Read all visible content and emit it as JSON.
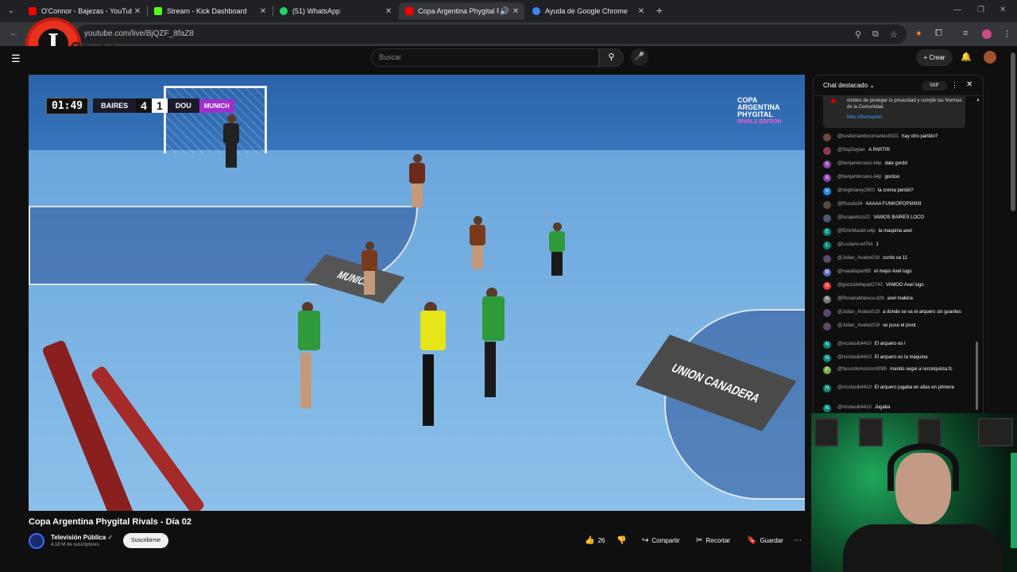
{
  "browser": {
    "tabs": [
      {
        "label": "O'Connor - Bajezas - YouTube",
        "favicon_color": "#ff0000",
        "active": false
      },
      {
        "label": "Stream - Kick Dashboard",
        "favicon_color": "#53fc18",
        "active": false
      },
      {
        "label": "(51) WhatsApp",
        "favicon_color": "#25d366",
        "active": false
      },
      {
        "label": "Copa Argentina Phygital Ri",
        "favicon_color": "#ff0000",
        "active": true
      },
      {
        "label": "Ayuda de Google Chrome",
        "favicon_color": "#4285f4",
        "active": false
      }
    ],
    "new_tab_icon": "plus-icon",
    "url": "youtube.com/live/BjQZF_8faZ8"
  },
  "overlay_logo": {
    "letter": "I",
    "text": "esaT"
  },
  "youtube": {
    "search_placeholder": "Buscar",
    "create_label": "Crear"
  },
  "video": {
    "scoreboard": {
      "time": "01:49",
      "home_team": "BAIRES",
      "home_score": "4",
      "away_score": "1",
      "away_team": "DOU",
      "sponsor": "MUNICH"
    },
    "corner_logo": {
      "line1": "COPA",
      "line2": "ARGENTINA",
      "line3": "PHYGITAL",
      "sub": "RIVALS EDITION"
    },
    "ad_left": "MUNICH",
    "ad_right": "UNION CANADERA",
    "title": "Copa Argentina Phygital Rivals - Día 02",
    "channel_name": "Televisión Pública",
    "channel_subs": "4,18 M de suscriptores",
    "subscribe_label": "Suscribirme",
    "likes": "26",
    "share_label": "Compartir",
    "clip_label": "Recortar",
    "save_label": "Guardar"
  },
  "chat": {
    "title": "Chat destacado",
    "xp": "0XP",
    "pinned_text": "olvides de proteger tu privacidad y cumplir las Normas de la Comunidad.",
    "pinned_more": "Más información",
    "messages": [
      {
        "user": "@luisfernandocorrantes9321",
        "text": "hay otro partido?",
        "initial": "",
        "color": "#6b4a3a"
      },
      {
        "user": "@SoyDaylan",
        "text": "A PARTIR",
        "initial": "",
        "color": "#8a3a5a"
      },
      {
        "user": "@benjamincano-b4p",
        "text": "dale gordd",
        "initial": "b",
        "color": "#8e44ad"
      },
      {
        "user": "@benjamincano-b4p",
        "text": "gordoo",
        "initial": "b",
        "color": "#8e44ad"
      },
      {
        "user": "@virginiarey2900",
        "text": "la crema perdió?",
        "initial": "V",
        "color": "#1e88e5"
      },
      {
        "user": "@Rucula34",
        "text": "AAAAA FUNKOPOPIIIIIIIII",
        "initial": "",
        "color": "#5a4a3a"
      },
      {
        "user": "@lucapelozo22",
        "text": "VAMOS BAIRES LOCO",
        "initial": "",
        "color": "#4a5a7a"
      },
      {
        "user": "@EmirMaciel-u4p",
        "text": "la maquina axel",
        "initial": "E",
        "color": "#00897b"
      },
      {
        "user": "@Luciano-wt7ks",
        "text": "1",
        "initial": "L",
        "color": "#00897b"
      },
      {
        "user": "@Julian_Avalos019",
        "text": "zurdo va 11",
        "initial": "",
        "color": "#5a4a6a"
      },
      {
        "user": "@maiallopart65",
        "text": "el mejor Axel lugo",
        "initial": "M",
        "color": "#5c6bc0"
      },
      {
        "user": "@gonzalollopart2743",
        "text": "VAMOO Axel lugo",
        "initial": "G",
        "color": "#e53935"
      },
      {
        "user": "@RosanaMareco-d2b",
        "text": "axel makina",
        "initial": "R",
        "color": "#757575"
      },
      {
        "user": "@Julian_Avalos019",
        "text": "a donde se va el arquero sin guantes",
        "initial": "",
        "color": "#5a4a6a"
      },
      {
        "user": "@Julian_Avalos019",
        "text": "se puso el pivot",
        "initial": "",
        "color": "#5a4a6a"
      },
      {
        "user": "@nicolasib4410",
        "text": "El arquero es l",
        "initial": "N",
        "color": "#00897b"
      },
      {
        "user": "@nicolasib4410",
        "text": "El arquero es la máquina",
        "initial": "N",
        "color": "#00897b"
      },
      {
        "user": "@facundomonzon3085",
        "text": "marido segui a reconquista fc",
        "initial": "F",
        "color": "#7cb342"
      },
      {
        "user": "@nicolasib4410",
        "text": "El arquero jugaba en alias en primera",
        "initial": "N",
        "color": "#00897b"
      },
      {
        "user": "@nicolasib4410",
        "text": "Jugaba",
        "initial": "N",
        "color": "#00897b"
      }
    ]
  }
}
